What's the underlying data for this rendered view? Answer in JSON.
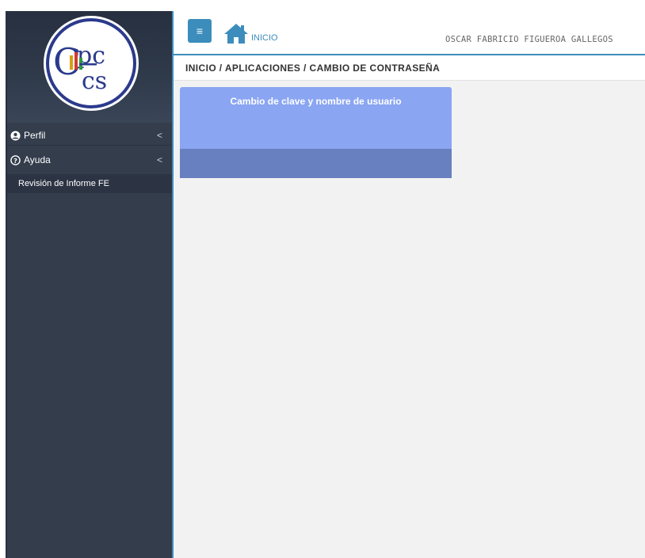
{
  "header": {
    "menu_toggle_glyph": "≡",
    "home_label": "INICIO",
    "user_name": "OSCAR FABRICIO FIGUEROA GALLEGOS"
  },
  "breadcrumb": {
    "text": "INICIO / APLICACIONES / CAMBIO DE CONTRASEÑA"
  },
  "sidebar": {
    "logo_text": "CpcCS",
    "items": [
      {
        "label": "Perfil",
        "icon": "user-circle-icon"
      },
      {
        "label": "Ayuda",
        "icon": "question-circle-icon"
      }
    ],
    "sub_item": {
      "label": "Revisión de Informe FE"
    },
    "chevron_glyph": "<"
  },
  "main": {
    "card_title": "Cambio de clave y nombre de usuario"
  },
  "colors": {
    "sidebar_bg": "#343d4c",
    "accent": "#3c8dbc",
    "card_top": "#8aa5f2",
    "card_bottom": "#6880bf",
    "content_bg": "#f2f2f2"
  }
}
